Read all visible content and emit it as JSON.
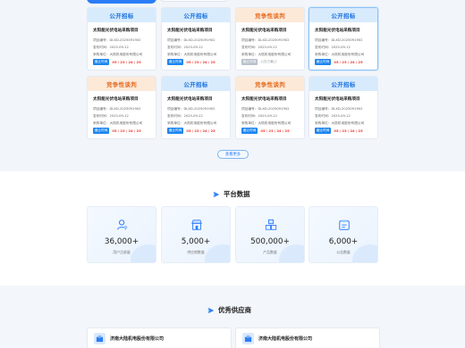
{
  "notices": [
    {
      "type": "公开招标",
      "kind": "public",
      "title": "太阳能光伏电站采购项目",
      "no_label": "项目编号：",
      "no": "DLXD-2025091902",
      "date_label": "发布时间：",
      "date": "2025-09-12",
      "buyer_label": "采购单位：",
      "buyer": "大陆机电股份有限公司",
      "status": "截止时间",
      "status_kind": "open",
      "deadline": "05 / 23 / 24 / 25"
    },
    {
      "type": "公开招标",
      "kind": "public",
      "title": "太阳能光伏电站采购项目",
      "no_label": "项目编号：",
      "no": "DLXD-2025091902",
      "date_label": "发布时间：",
      "date": "2025-09-12",
      "buyer_label": "采购单位：",
      "buyer": "大陆机电股份有限公司",
      "status": "截止时间",
      "status_kind": "open",
      "deadline": "05 / 23 / 24 / 25"
    },
    {
      "type": "竞争性谈判",
      "kind": "comp",
      "title": "太阳能光伏电站采购项目",
      "no_label": "项目编号：",
      "no": "DLXD-2025091902",
      "date_label": "发布时间：",
      "date": "2025-09-12",
      "buyer_label": "采购单位：",
      "buyer": "大陆机电股份有限公司",
      "status": "截止时间",
      "status_kind": "closed",
      "deadline": "公告已截止"
    },
    {
      "type": "公开招标",
      "kind": "public",
      "title": "太阳能光伏电站采购项目",
      "no_label": "项目编号：",
      "no": "DLXD-2025091902",
      "date_label": "发布时间：",
      "date": "2025-09-12",
      "buyer_label": "采购单位：",
      "buyer": "大陆机电股份有限公司",
      "status": "截止时间",
      "status_kind": "open",
      "deadline": "05 / 23 / 24 / 25"
    },
    {
      "type": "竞争性谈判",
      "kind": "comp",
      "title": "太阳能光伏电站采购项目",
      "no_label": "项目编号：",
      "no": "DLXD-2025091902",
      "date_label": "发布时间：",
      "date": "2025-09-12",
      "buyer_label": "采购单位：",
      "buyer": "大陆机电股份有限公司",
      "status": "截止时间",
      "status_kind": "open",
      "deadline": "05 / 23 / 24 / 25"
    },
    {
      "type": "公开招标",
      "kind": "public",
      "title": "太阳能光伏电站采购项目",
      "no_label": "项目编号：",
      "no": "DLXD-2025091902",
      "date_label": "发布时间：",
      "date": "2025-09-12",
      "buyer_label": "采购单位：",
      "buyer": "大陆机电股份有限公司",
      "status": "截止时间",
      "status_kind": "open",
      "deadline": "05 / 23 / 24 / 25"
    },
    {
      "type": "竞争性谈判",
      "kind": "comp",
      "title": "太阳能光伏电站采购项目",
      "no_label": "项目编号：",
      "no": "DLXD-2025091902",
      "date_label": "发布时间：",
      "date": "2025-09-12",
      "buyer_label": "采购单位：",
      "buyer": "大陆机电股份有限公司",
      "status": "截止时间",
      "status_kind": "open",
      "deadline": "05 / 23 / 24 / 25"
    },
    {
      "type": "公开招标",
      "kind": "public",
      "title": "太阳能光伏电站采购项目",
      "no_label": "项目编号：",
      "no": "DLXD-2025091902",
      "date_label": "发布时间：",
      "date": "2025-09-12",
      "buyer_label": "采购单位：",
      "buyer": "大陆机电股份有限公司",
      "status": "截止时间",
      "status_kind": "open",
      "deadline": "05 / 23 / 24 / 25"
    }
  ],
  "more_button": "查看更多",
  "platform": {
    "title": "平台数据",
    "stats": [
      {
        "value": "36,000+",
        "label": "用户注册量",
        "icon": "users-icon"
      },
      {
        "value": "5,000+",
        "label": "供应商数量",
        "icon": "store-icon"
      },
      {
        "value": "500,000+",
        "label": "产品数量",
        "icon": "products-icon"
      },
      {
        "value": "6,000+",
        "label": "公告数量",
        "icon": "notice-icon"
      }
    ]
  },
  "suppliers": {
    "title": "优秀供应商",
    "items": [
      {
        "name": "济南大陆机电股份有限公司"
      },
      {
        "name": "济南大陆机电股份有限公司"
      }
    ]
  },
  "colors": {
    "accent": "#2b7df7",
    "public_head": "#d8ebfd",
    "comp_head": "#fde9d8",
    "deadline": "#ee3b35"
  }
}
